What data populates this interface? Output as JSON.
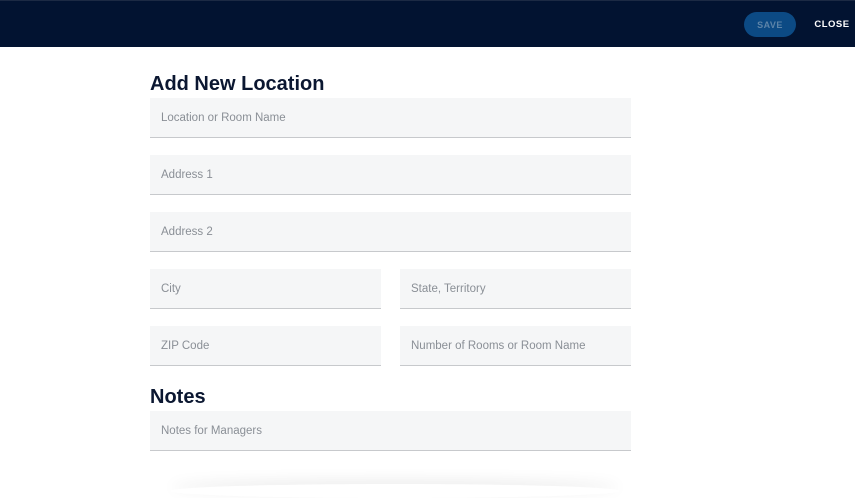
{
  "header": {
    "save_label": "SAVE",
    "close_label": "CLOSE"
  },
  "form": {
    "title": "Add New Location",
    "location_name": {
      "placeholder": "Location or Room Name",
      "value": ""
    },
    "address1": {
      "placeholder": "Address 1",
      "value": ""
    },
    "address2": {
      "placeholder": "Address 2",
      "value": ""
    },
    "city": {
      "placeholder": "City",
      "value": ""
    },
    "state": {
      "placeholder": "State, Territory",
      "value": ""
    },
    "zip": {
      "placeholder": "ZIP Code",
      "value": ""
    },
    "rooms": {
      "placeholder": "Number of Rooms or Room Name",
      "value": ""
    }
  },
  "notes": {
    "title": "Notes",
    "managers_notes": {
      "placeholder": "Notes for Managers",
      "value": ""
    }
  },
  "colors": {
    "header_bg": "#021331",
    "save_bg": "#0c4a84",
    "field_bg": "#f5f6f7"
  }
}
